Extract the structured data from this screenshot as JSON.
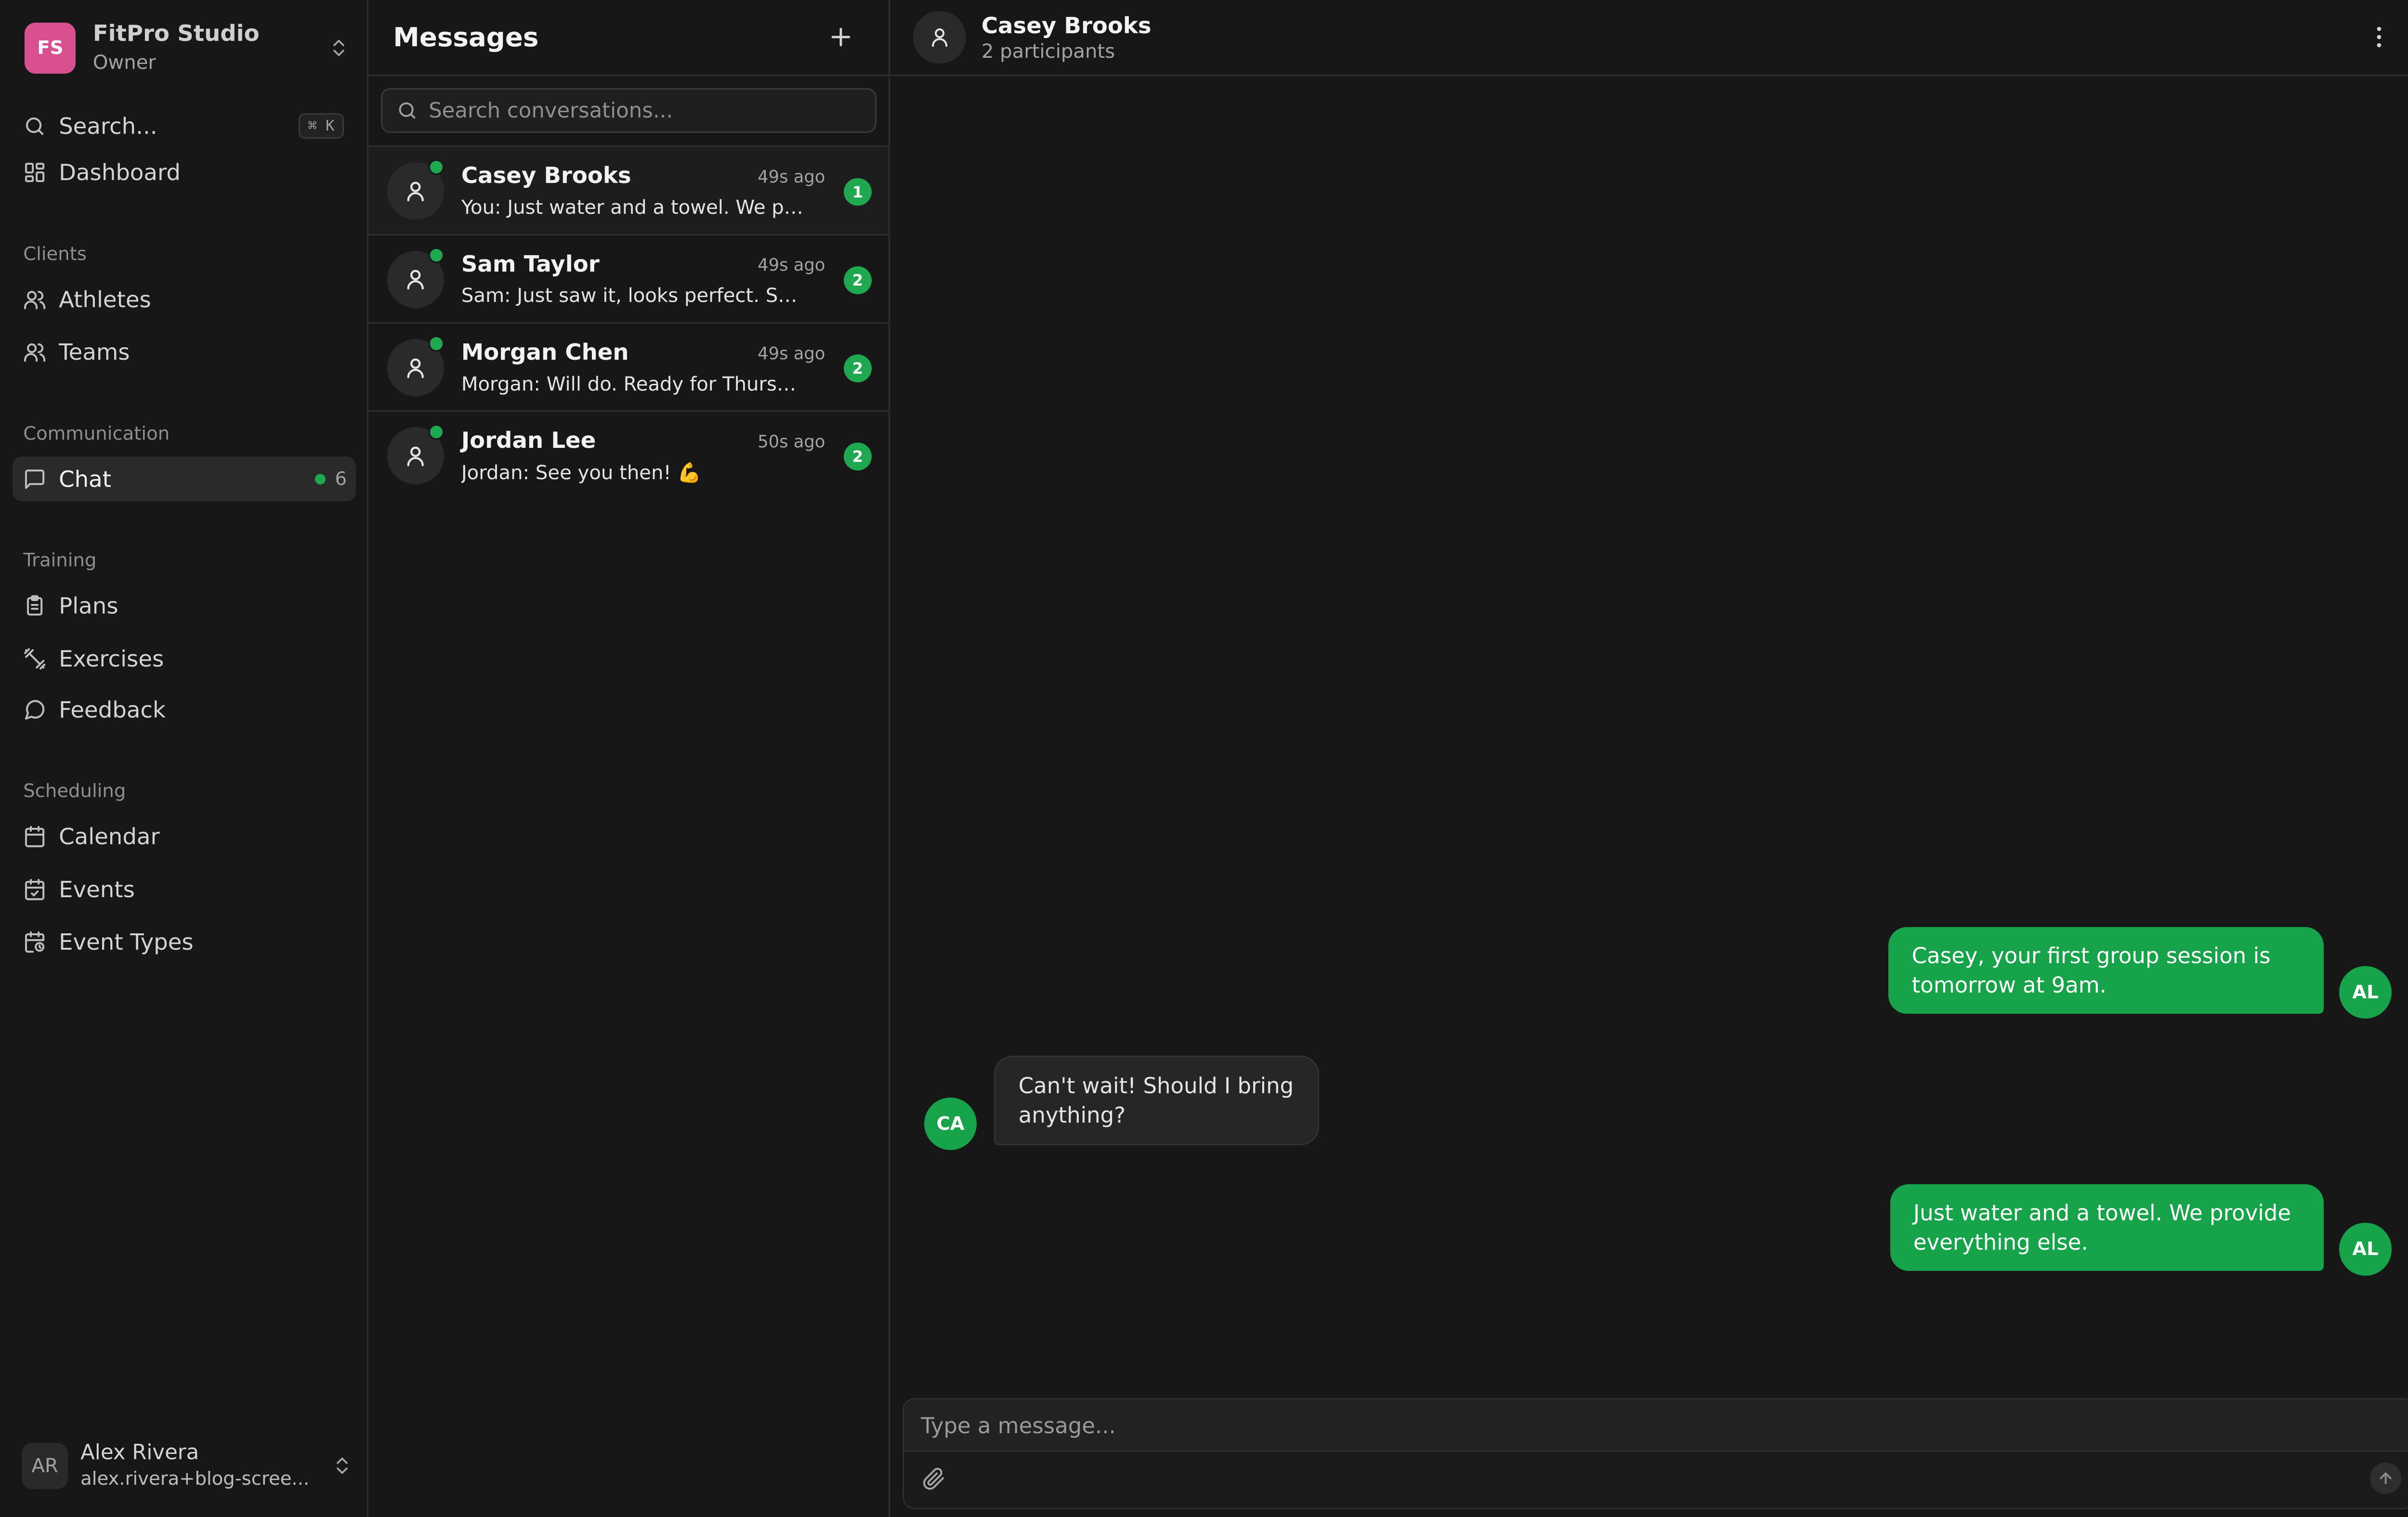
{
  "org": {
    "initials": "FS",
    "name": "FitPro Studio",
    "role": "Owner"
  },
  "search": {
    "label": "Search...",
    "shortcut": "⌘ K"
  },
  "nav": {
    "dashboard": "Dashboard",
    "clients_label": "Clients",
    "athletes": "Athletes",
    "teams": "Teams",
    "communication_label": "Communication",
    "chat": "Chat",
    "chat_badge": "6",
    "training_label": "Training",
    "plans": "Plans",
    "exercises": "Exercises",
    "feedback": "Feedback",
    "scheduling_label": "Scheduling",
    "calendar": "Calendar",
    "events": "Events",
    "event_types": "Event Types"
  },
  "user": {
    "initials": "AR",
    "name": "Alex Rivera",
    "email": "alex.rivera+blog-scree..."
  },
  "messages_panel": {
    "title": "Messages",
    "search_placeholder": "Search conversations...",
    "conversations": [
      {
        "name": "Casey Brooks",
        "time": "49s ago",
        "preview": "You: Just water and a towel. We pro...",
        "unread": "1"
      },
      {
        "name": "Sam Taylor",
        "time": "49s ago",
        "preview": "Sam: Just saw it, looks perfect. Se...",
        "unread": "2"
      },
      {
        "name": "Morgan Chen",
        "time": "49s ago",
        "preview": "Morgan: Will do. Ready for Thursday!",
        "unread": "2"
      },
      {
        "name": "Jordan Lee",
        "time": "50s ago",
        "preview": "Jordan: See you then! 💪",
        "unread": "2"
      }
    ]
  },
  "chat": {
    "title": "Casey Brooks",
    "subtitle": "2 participants",
    "messages": [
      {
        "from": "AL",
        "text": "Casey, your first group session is tomorrow at 9am."
      },
      {
        "from": "CA",
        "text": "Can't wait! Should I bring anything?"
      },
      {
        "from": "AL",
        "text": "Just water and a towel. We provide everything else."
      }
    ],
    "composer_placeholder": "Type a message..."
  },
  "colors": {
    "accent": "#17a34a",
    "org_logo": "#d8508f",
    "background": "#171717"
  }
}
